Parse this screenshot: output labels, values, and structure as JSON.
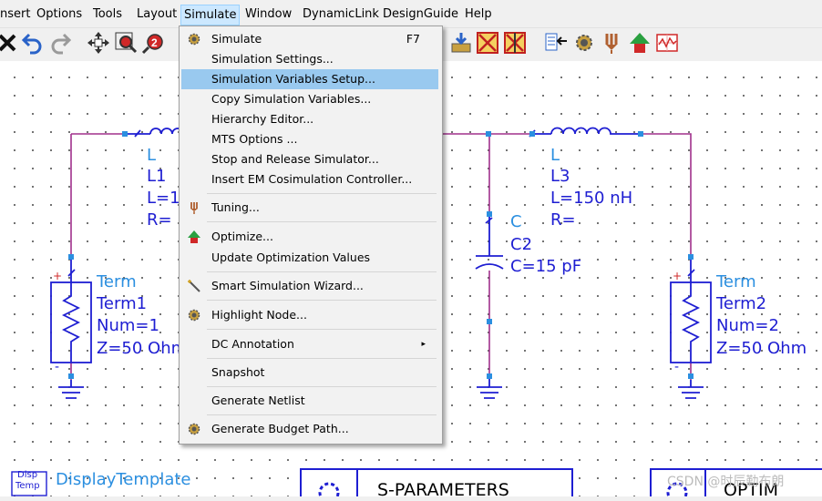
{
  "menubar": {
    "items": [
      "nsert",
      "Options",
      "Tools",
      "Layout",
      "Simulate",
      "Window",
      "DynamicLink",
      "DesignGuide",
      "Help"
    ]
  },
  "simulate_menu": {
    "items": [
      {
        "label": "Simulate",
        "shortcut": "F7",
        "icon": "gear-icon"
      },
      {
        "label": "Simulation Settings..."
      },
      {
        "label": "Simulation Variables Setup..."
      },
      {
        "label": "Copy Simulation Variables..."
      },
      {
        "label": "Hierarchy Editor..."
      },
      {
        "label": "MTS Options ..."
      },
      {
        "label": "Stop and Release Simulator..."
      },
      {
        "label": "Insert EM Cosimulation Controller..."
      },
      {
        "label": "Tuning...",
        "icon": "tuning-fork-icon"
      },
      {
        "label": "Optimize...",
        "icon": "optimize-icon"
      },
      {
        "label": "Update Optimization Values"
      },
      {
        "label": "Smart Simulation Wizard...",
        "icon": "wand-icon"
      },
      {
        "label": "Highlight Node...",
        "icon": "gear-icon"
      },
      {
        "label": "DC Annotation",
        "submenu_arrow": "▸"
      },
      {
        "label": "Snapshot"
      },
      {
        "label": "Generate Netlist"
      },
      {
        "label": "Generate Budget Path...",
        "icon": "gear-icon"
      }
    ]
  },
  "schematic": {
    "l1": {
      "type": "L",
      "name": "L1",
      "value": "L=1",
      "r": "R="
    },
    "l3": {
      "type": "L",
      "name": "L3",
      "value": "L=150 nH",
      "r": "R="
    },
    "c2": {
      "type": "C",
      "name": "C2",
      "value": "C=15 pF"
    },
    "term1": {
      "type": "Term",
      "name": "Term1",
      "num": "Num=1",
      "z": "Z=50 Ohm"
    },
    "term2": {
      "type": "Term",
      "name": "Term2",
      "num": "Num=2",
      "z": "Z=50 Ohm"
    },
    "display_template": {
      "icon_line1": "Disp",
      "icon_line2": "Temp",
      "label": "DisplayTemplate"
    },
    "sparams_block": "S-PARAMETERS",
    "optim_block": "OPTIM",
    "terminal_plus": "+",
    "terminal_minus": "-"
  },
  "watermark": "CSDN @时辰勤布朗",
  "colors": {
    "wire": "#a0308c",
    "component": "#1e1ed2",
    "label_type": "#2b8fe0",
    "menu_highlight": "#99c9ef"
  }
}
